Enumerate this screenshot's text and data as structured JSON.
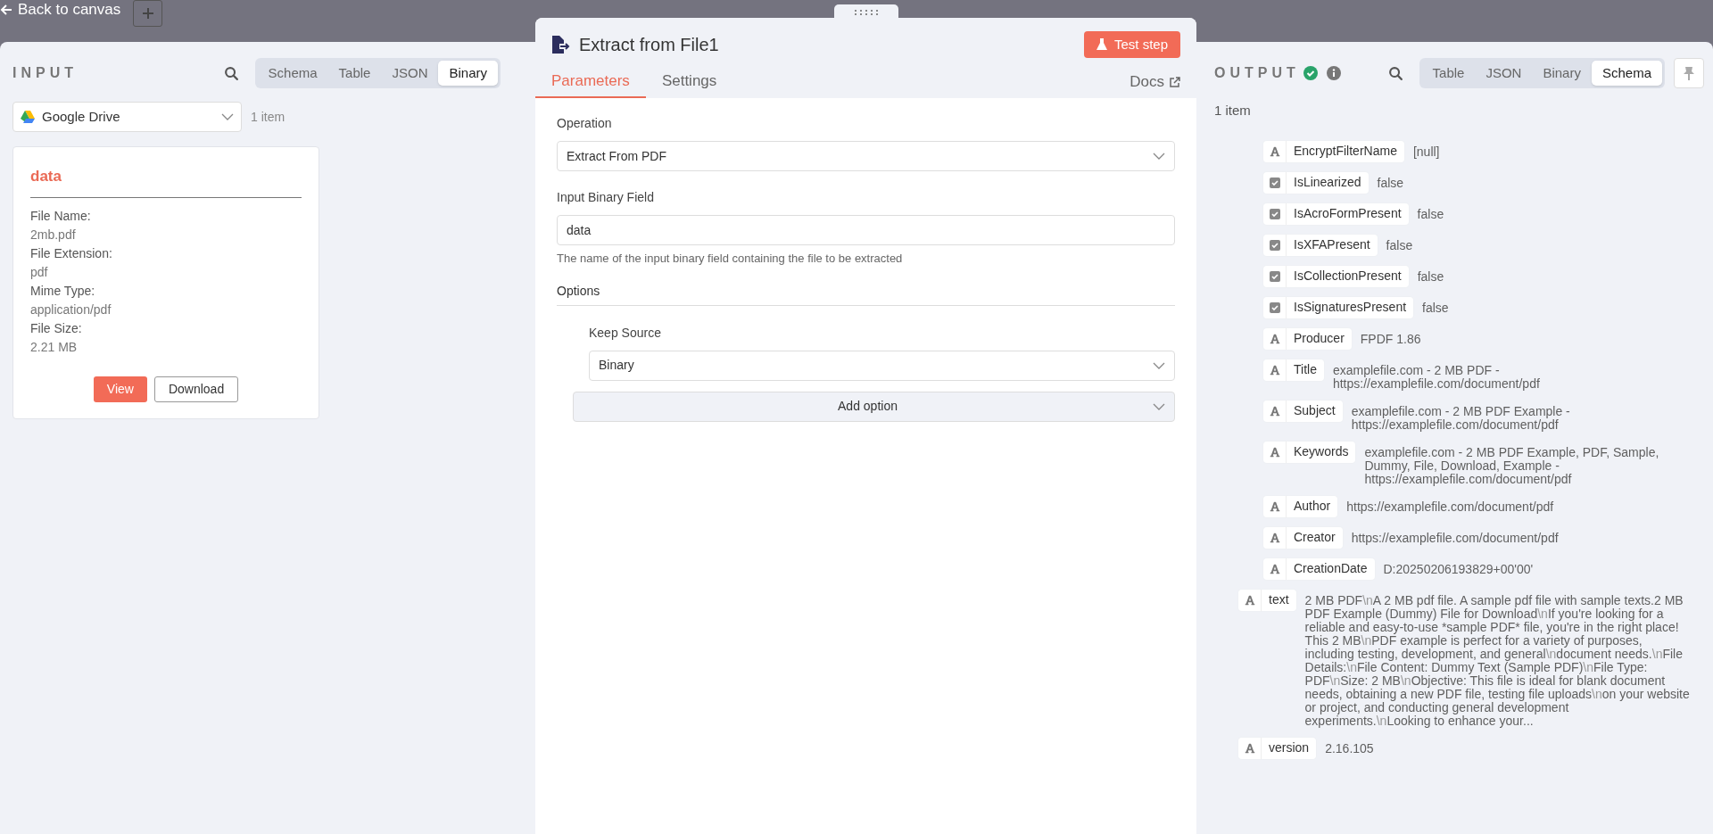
{
  "top_bar": {
    "back_label": "Back to canvas"
  },
  "input": {
    "title": "INPUT",
    "tabs": [
      {
        "label": "Schema",
        "selected": false
      },
      {
        "label": "Table",
        "selected": false
      },
      {
        "label": "JSON",
        "selected": false
      },
      {
        "label": "Binary",
        "selected": true
      }
    ],
    "source": {
      "value": "Google Drive"
    },
    "count": "1 item",
    "card": {
      "title": "data",
      "lines": [
        "File Name:",
        "2mb.pdf",
        "File Extension:",
        "pdf",
        "Mime Type:",
        "application/pdf",
        "File Size:",
        "2.21 MB"
      ],
      "buttons": [
        {
          "label": "View",
          "kind": "primary"
        },
        {
          "label": "Download",
          "kind": "secondary"
        }
      ]
    }
  },
  "node": {
    "title": "Extract from File1",
    "test_button": "Test step",
    "tabs": [
      {
        "label": "Parameters",
        "selected": true
      },
      {
        "label": "Settings",
        "selected": false
      }
    ],
    "docs": "Docs",
    "operation": {
      "label": "Operation",
      "value": "Extract From PDF"
    },
    "binary_field": {
      "label": "Input Binary Field",
      "value": "data",
      "hint": "The name of the input binary field containing the file to be extracted"
    },
    "options": {
      "label": "Options",
      "keep_source": {
        "label": "Keep Source",
        "value": "Binary"
      },
      "add_option": "Add option"
    }
  },
  "output": {
    "title": "OUTPUT",
    "tabs": [
      {
        "label": "Table",
        "selected": false
      },
      {
        "label": "JSON",
        "selected": false
      },
      {
        "label": "Binary",
        "selected": false
      },
      {
        "label": "Schema",
        "selected": true
      }
    ],
    "count": "1 item",
    "schema": [
      {
        "children": [
          {
            "kind": "string",
            "name": "EncryptFilterName",
            "value": "[null]"
          },
          {
            "kind": "boolean",
            "name": "IsLinearized",
            "value": "false"
          },
          {
            "kind": "boolean",
            "name": "IsAcroFormPresent",
            "value": "false"
          },
          {
            "kind": "boolean",
            "name": "IsXFAPresent",
            "value": "false"
          },
          {
            "kind": "boolean",
            "name": "IsCollectionPresent",
            "value": "false"
          },
          {
            "kind": "boolean",
            "name": "IsSignaturesPresent",
            "value": "false"
          },
          {
            "kind": "string",
            "name": "Producer",
            "value": "FPDF 1.86"
          },
          {
            "kind": "string",
            "name": "Title",
            "value": "examplefile.com - 2 MB PDF - https://examplefile.com/document/pdf"
          },
          {
            "kind": "string",
            "name": "Subject",
            "value": "examplefile.com - 2 MB PDF Example - https://examplefile.com/document/pdf"
          },
          {
            "kind": "string",
            "name": "Keywords",
            "value": "examplefile.com - 2 MB PDF Example, PDF, Sample, Dummy, File, Download, Example - https://examplefile.com/document/pdf"
          },
          {
            "kind": "string",
            "name": "Author",
            "value": "https://examplefile.com/document/pdf"
          },
          {
            "kind": "string",
            "name": "Creator",
            "value": "https://examplefile.com/document/pdf"
          },
          {
            "kind": "string",
            "name": "CreationDate",
            "value": "D:20250206193829+00'00'"
          }
        ]
      },
      {
        "kind": "string",
        "name": "text",
        "value": "2 MB PDF\\nA 2 MB pdf file. A sample pdf file with sample texts.2 MB PDF Example (Dummy) File for Download\\nIf you're looking for a reliable and easy-to-use *sample PDF* file, you're in the right place! This 2 MB\\nPDF example is perfect for a variety of purposes, including testing, development, and general\\ndocument needs.\\nFile Details:\\nFile Content: Dummy Text (Sample PDF)\\nFile Type: PDF\\nSize: 2 MB\\nObjective: This file is ideal for blank document needs, obtaining a new PDF file, testing file uploads\\non your website or project, and conducting general development experiments.\\nLooking to enhance your..."
      },
      {
        "kind": "string",
        "name": "version",
        "value": "2.16.105"
      }
    ]
  }
}
